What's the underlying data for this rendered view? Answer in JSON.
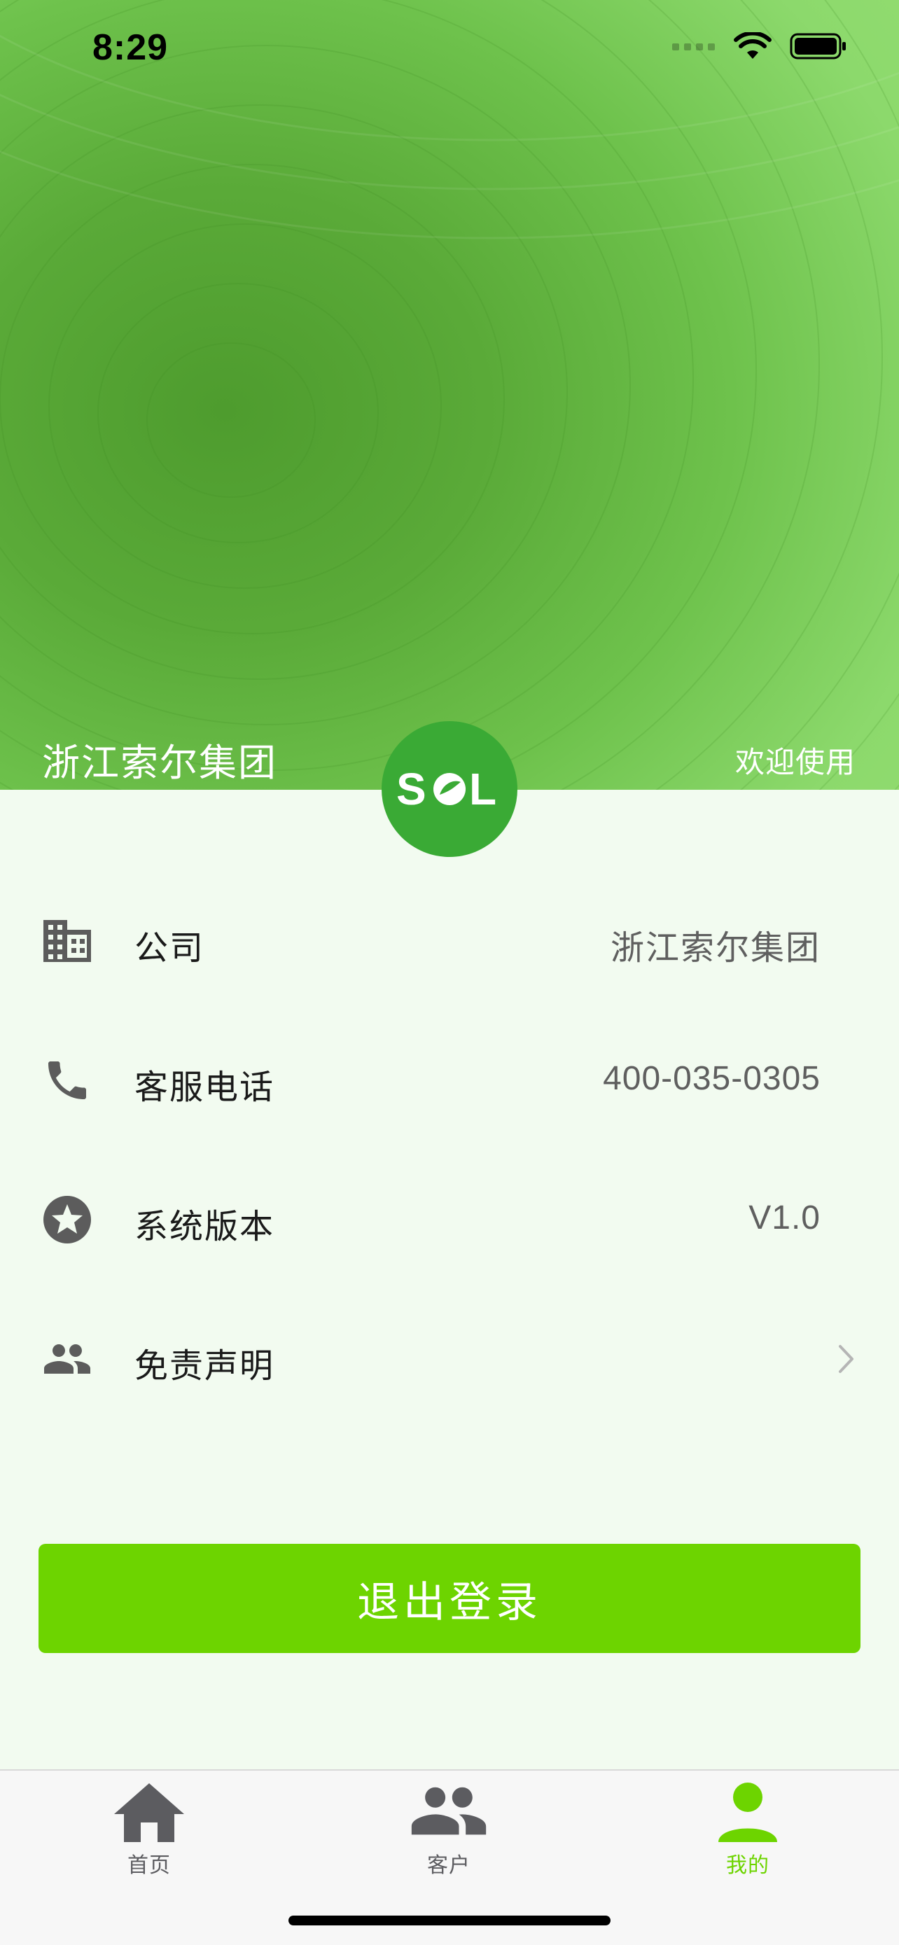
{
  "status_bar": {
    "time": "8:29"
  },
  "header": {
    "company_name": "浙江索尔集团",
    "welcome": "欢迎使用",
    "logo_text": "SOL"
  },
  "info_rows": [
    {
      "icon": "building-icon",
      "label": "公司",
      "value": "浙江索尔集团"
    },
    {
      "icon": "phone-icon",
      "label": "客服电话",
      "value": "400-035-0305"
    },
    {
      "icon": "star-icon",
      "label": "系统版本",
      "value": "V1.0"
    },
    {
      "icon": "people-icon",
      "label": "免责声明",
      "value": ""
    }
  ],
  "logout_label": "退出登录",
  "tabs": [
    {
      "icon": "home-icon",
      "label": "首页",
      "active": false
    },
    {
      "icon": "customers-icon",
      "label": "客户",
      "active": false
    },
    {
      "icon": "profile-icon",
      "label": "我的",
      "active": true
    }
  ],
  "colors": {
    "accent": "#6dd400",
    "logo_bg": "#3aaa35",
    "icon_gray": "#5c5c5c",
    "tab_inactive": "#5c5c60",
    "page_bg": "#f2fbf0"
  }
}
